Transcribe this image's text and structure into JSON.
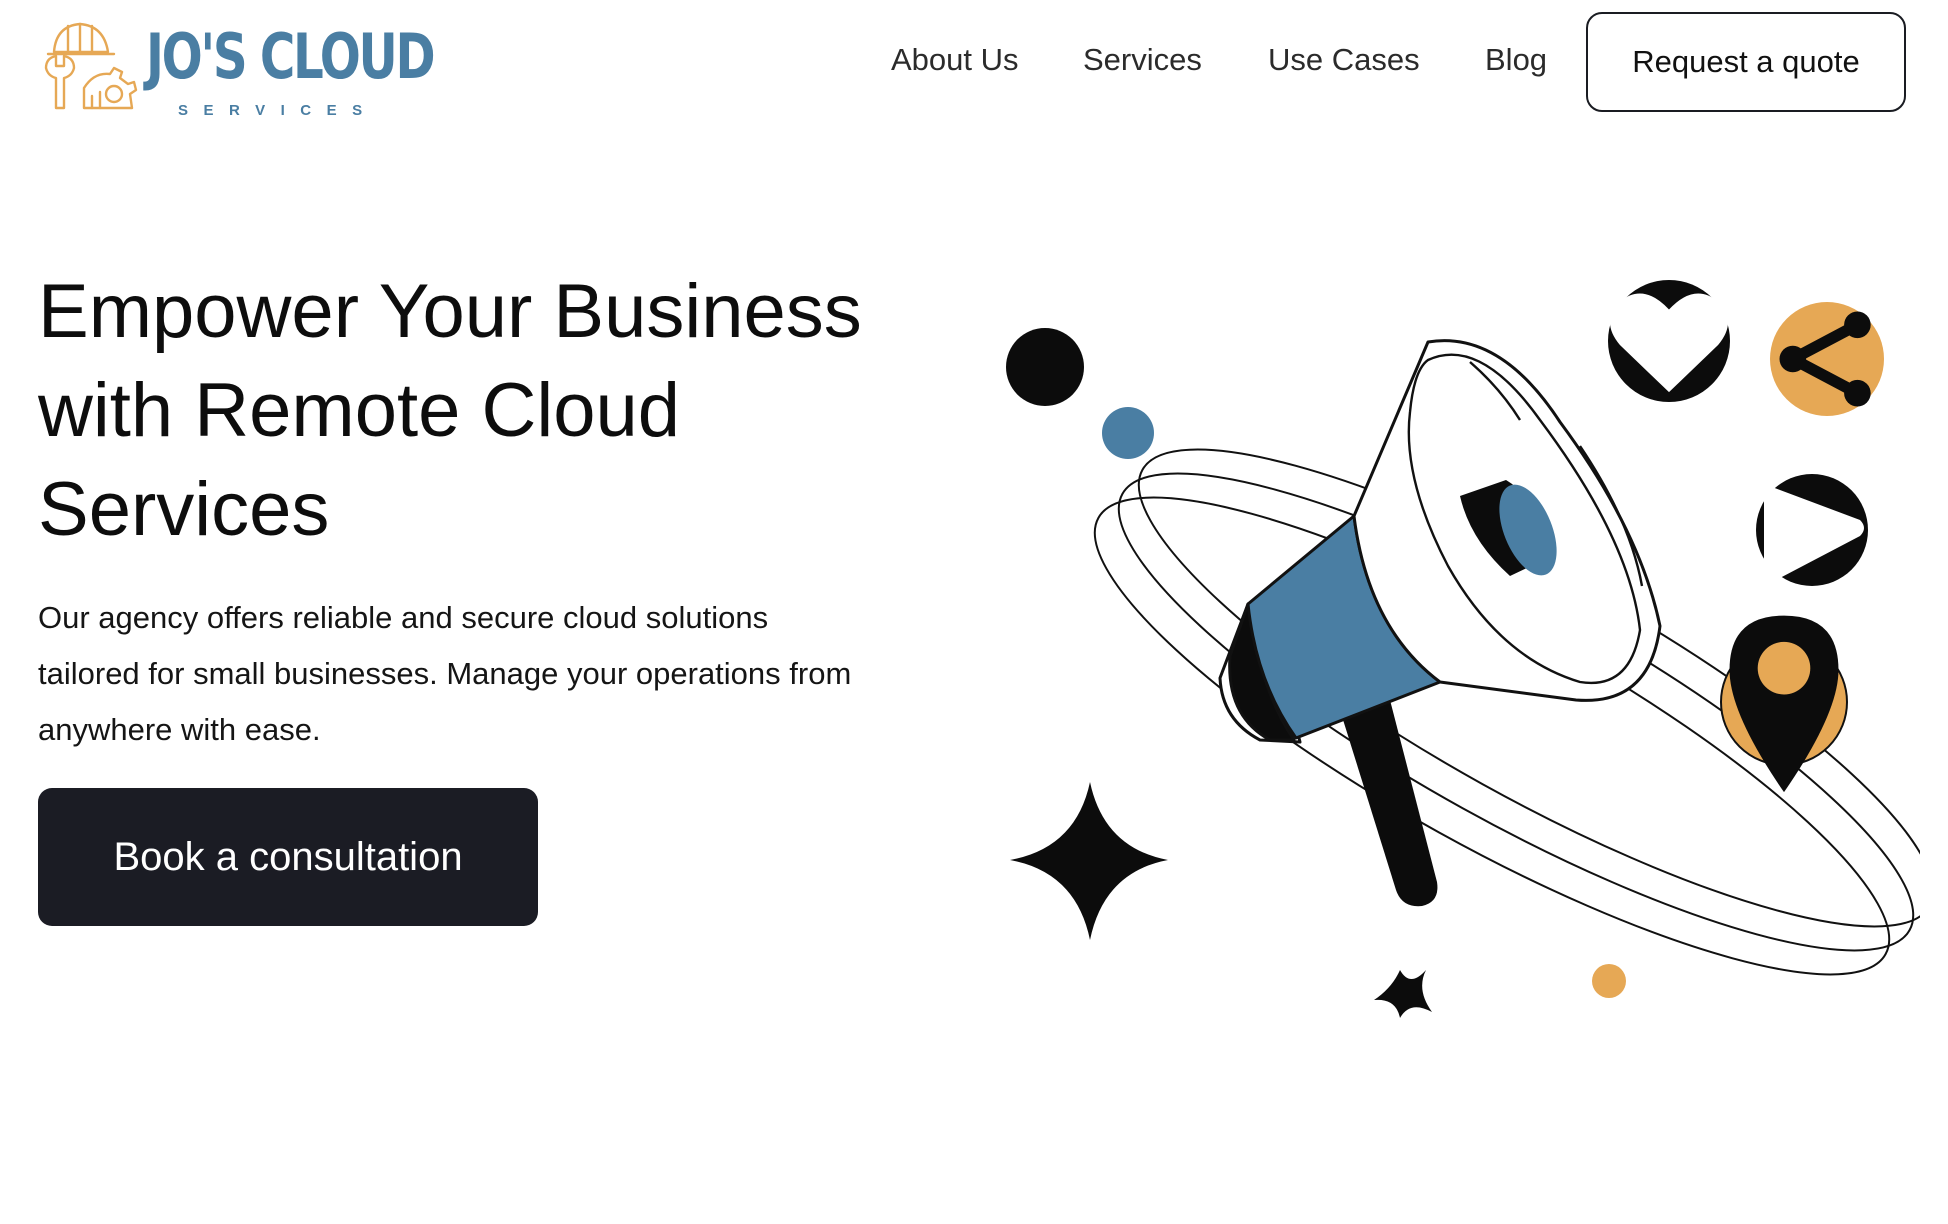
{
  "header": {
    "logo_text": "JO'S CLOUD",
    "logo_subtext": "SERVICES",
    "nav": [
      {
        "label": "About Us"
      },
      {
        "label": "Services"
      },
      {
        "label": "Use Cases"
      },
      {
        "label": "Blog"
      }
    ],
    "quote_button": "Request a quote"
  },
  "hero": {
    "title": "Empower Your Business with Remote Cloud Services",
    "description": "Our agency offers reliable and secure cloud solutions tailored for small businesses. Manage your operations from anywhere with ease.",
    "cta": "Book a consultation"
  },
  "illustration": {
    "icons": [
      "megaphone-icon",
      "heart-icon",
      "share-icon",
      "play-icon",
      "location-pin-icon",
      "sparkle-star-icon"
    ]
  },
  "colors": {
    "brand_blue": "#4a7ea3",
    "brand_orange": "#e6a855",
    "dark": "#1b1c24",
    "background": "#ffffff"
  }
}
